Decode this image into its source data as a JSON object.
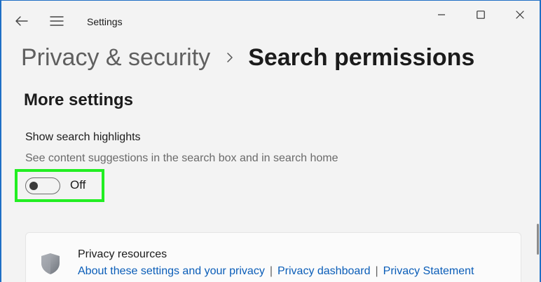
{
  "window": {
    "app_title": "Settings",
    "accent_color": "#1f6fc5"
  },
  "titlebar": {
    "back_icon": "arrow-left-icon",
    "menu_icon": "hamburger-menu-icon",
    "controls": [
      "minimize-icon",
      "maximize-icon",
      "close-icon"
    ]
  },
  "breadcrumb": {
    "parent": "Privacy & security",
    "separator_icon": "chevron-right-icon",
    "current": "Search permissions"
  },
  "section": {
    "title": "More settings"
  },
  "setting": {
    "title": "Show search highlights",
    "description": "See content suggestions in the search box and in search home",
    "toggle_state": "Off",
    "toggle_on": false,
    "highlight_color": "#22ee22"
  },
  "privacy_card": {
    "icon": "shield-icon",
    "title": "Privacy resources",
    "links": [
      "About these settings and your privacy",
      "Privacy dashboard",
      "Privacy Statement"
    ],
    "link_separator": "|",
    "link_color": "#0a5db8"
  }
}
